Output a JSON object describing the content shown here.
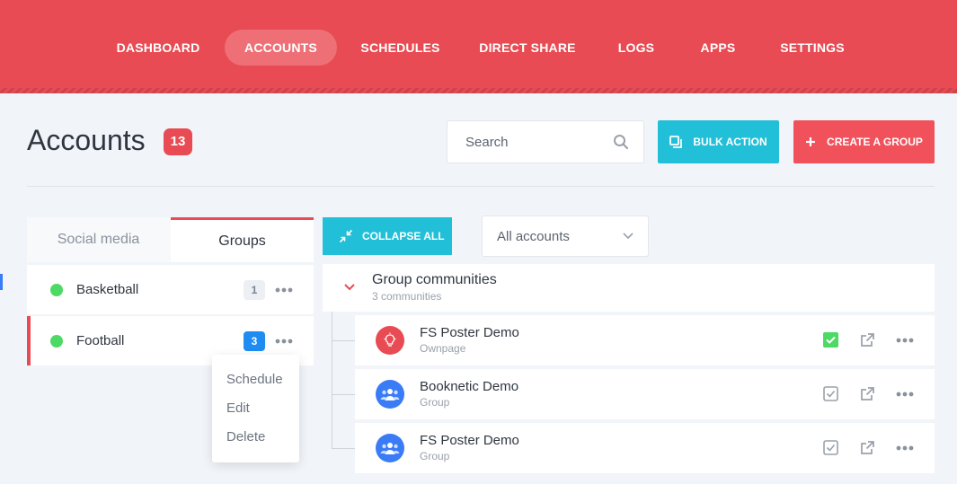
{
  "nav": {
    "items": [
      {
        "label": "DASHBOARD"
      },
      {
        "label": "ACCOUNTS"
      },
      {
        "label": "SCHEDULES"
      },
      {
        "label": "DIRECT SHARE"
      },
      {
        "label": "LOGS"
      },
      {
        "label": "APPS"
      },
      {
        "label": "SETTINGS"
      }
    ],
    "active": "ACCOUNTS"
  },
  "header": {
    "title": "Accounts",
    "count": "13",
    "search_placeholder": "Search",
    "bulk_action_label": "BULK ACTION",
    "create_group_label": "CREATE A GROUP"
  },
  "left_panel": {
    "tabs": [
      {
        "label": "Social media"
      },
      {
        "label": "Groups"
      }
    ],
    "active_tab": "Groups",
    "groups": [
      {
        "name": "Basketball",
        "count": "1"
      },
      {
        "name": "Football",
        "count": "3"
      }
    ],
    "context_menu": [
      "Schedule",
      "Edit",
      "Delete"
    ]
  },
  "toolbar": {
    "collapse_label": "COLLAPSE ALL",
    "filter_value": "All accounts"
  },
  "community_group": {
    "title": "Group communities",
    "subtitle": "3 communities",
    "accounts": [
      {
        "name": "FS Poster Demo",
        "type": "Ownpage",
        "checked": true
      },
      {
        "name": "Booknetic Demo",
        "type": "Group",
        "checked": false
      },
      {
        "name": "FS Poster Demo",
        "type": "Group",
        "checked": false
      }
    ]
  },
  "colors": {
    "brand_red": "#e84b53",
    "accent_cyan": "#22bfd8",
    "status_green": "#4cd964",
    "badge_blue": "#1f8cf2"
  }
}
